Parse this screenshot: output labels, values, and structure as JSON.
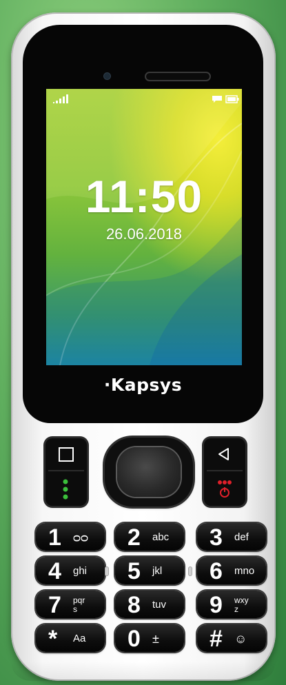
{
  "screen": {
    "time": "11:50",
    "date": "26.06.2018",
    "status_icons": [
      "signal-icon",
      "message-icon",
      "battery-icon"
    ]
  },
  "brand": "·Kapsys",
  "softkeys": {
    "left_icons": [
      "square-icon",
      "call-icon"
    ],
    "right_icons": [
      "back-icon",
      "end-call-icon"
    ]
  },
  "keypad": [
    {
      "digit": "1",
      "letters": "ᴑᴑ"
    },
    {
      "digit": "2",
      "letters": "abc"
    },
    {
      "digit": "3",
      "letters": "def"
    },
    {
      "digit": "4",
      "letters": "ghi"
    },
    {
      "digit": "5",
      "letters": "jkl"
    },
    {
      "digit": "6",
      "letters": "mno"
    },
    {
      "digit": "7",
      "letters": "pqrs"
    },
    {
      "digit": "8",
      "letters": "tuv"
    },
    {
      "digit": "9",
      "letters": "wxyz"
    },
    {
      "digit": "*",
      "letters": "Aa"
    },
    {
      "digit": "0",
      "letters": "±"
    },
    {
      "digit": "#",
      "letters": "☺"
    }
  ],
  "colors": {
    "call_green": "#3bbf3b",
    "end_red": "#e0202a"
  }
}
